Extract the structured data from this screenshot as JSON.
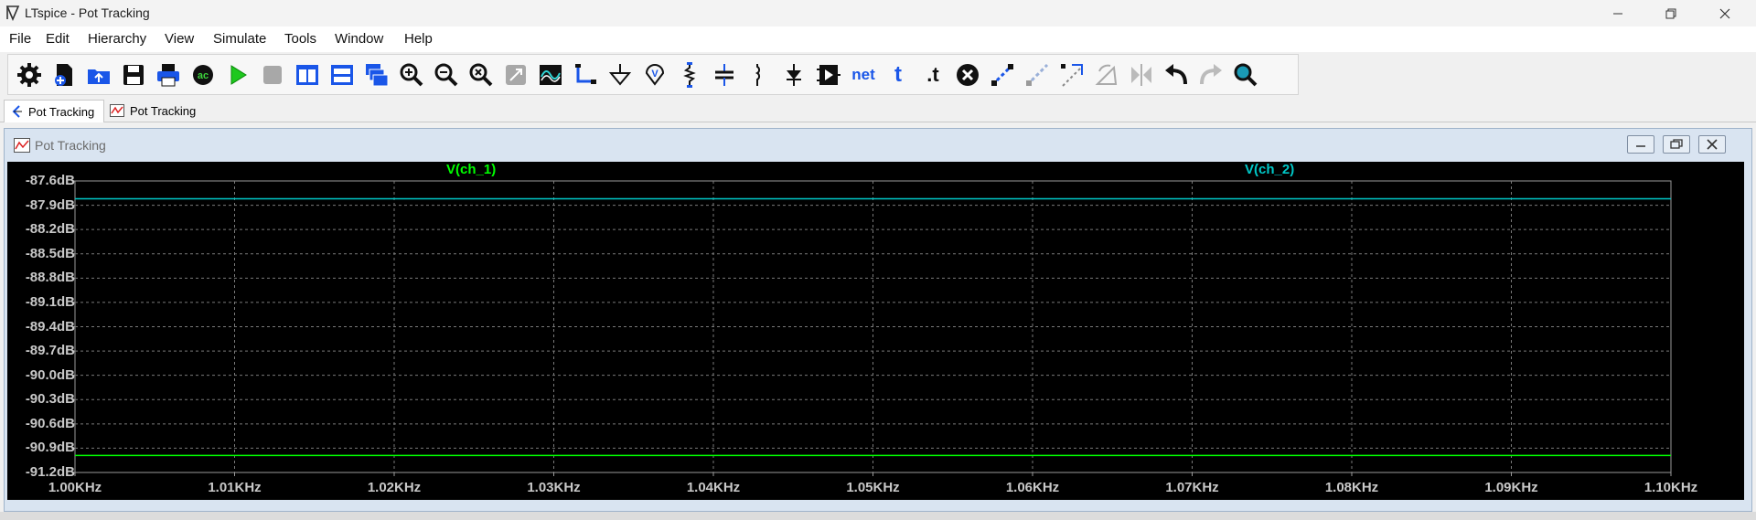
{
  "window": {
    "title": "LTspice - Pot Tracking"
  },
  "menu": [
    "File",
    "Edit",
    "Hierarchy",
    "View",
    "Simulate",
    "Tools",
    "Window",
    "Help"
  ],
  "toolbar": {
    "icons": [
      "gear-icon",
      "new-schematic-icon",
      "open-icon",
      "save-icon",
      "print-icon",
      "ac-run-icon",
      "run-icon",
      "halt-icon",
      "tile-vertical-icon",
      "tile-horizontal-icon",
      "cascade-icon",
      "zoom-in-icon",
      "zoom-out-icon",
      "zoom-fit-icon",
      "zoom-extents-icon",
      "waveform-icon",
      "wire-icon",
      "ground-icon",
      "voltage-probe-icon",
      "resistor-icon",
      "capacitor-icon",
      "inductor-icon",
      "diode-icon",
      "component-icon",
      "net-label-icon",
      "text-icon",
      "spice-directive-icon",
      "delete-icon",
      "duplicate-icon",
      "move-icon",
      "drag-icon",
      "rotate-icon",
      "mirror-icon",
      "undo-icon",
      "redo-icon",
      "find-icon"
    ],
    "net_label": "net",
    "text_label": "t",
    "directive_label": ".t"
  },
  "tabs": [
    {
      "label": "Pot Tracking",
      "active": true
    },
    {
      "label": "Pot Tracking",
      "active": false
    }
  ],
  "plot_window": {
    "title": "Pot Tracking"
  },
  "colors": {
    "ch1": "#00ff00",
    "ch2": "#00c8c8",
    "plot_bg": "#000000",
    "grid": "#7a7a7a"
  },
  "chart_data": {
    "type": "line",
    "x_tick_labels": [
      "1.00KHz",
      "1.01KHz",
      "1.02KHz",
      "1.03KHz",
      "1.04KHz",
      "1.05KHz",
      "1.06KHz",
      "1.07KHz",
      "1.08KHz",
      "1.09KHz",
      "1.10KHz"
    ],
    "y_tick_labels": [
      "-87.6dB",
      "-87.9dB",
      "-88.2dB",
      "-88.5dB",
      "-88.8dB",
      "-89.1dB",
      "-89.4dB",
      "-89.7dB",
      "-90.0dB",
      "-90.3dB",
      "-90.6dB",
      "-90.9dB",
      "-91.2dB"
    ],
    "xlim": [
      1000,
      1100
    ],
    "ylim": [
      -91.2,
      -87.6
    ],
    "grid": true,
    "series": [
      {
        "name": "V(ch_1)",
        "x": [
          1000,
          1100
        ],
        "y": [
          -90.99,
          -90.99
        ],
        "color": "#00ff00"
      },
      {
        "name": "V(ch_2)",
        "x": [
          1000,
          1100
        ],
        "y": [
          -87.82,
          -87.82
        ],
        "color": "#00c8c8"
      }
    ]
  }
}
